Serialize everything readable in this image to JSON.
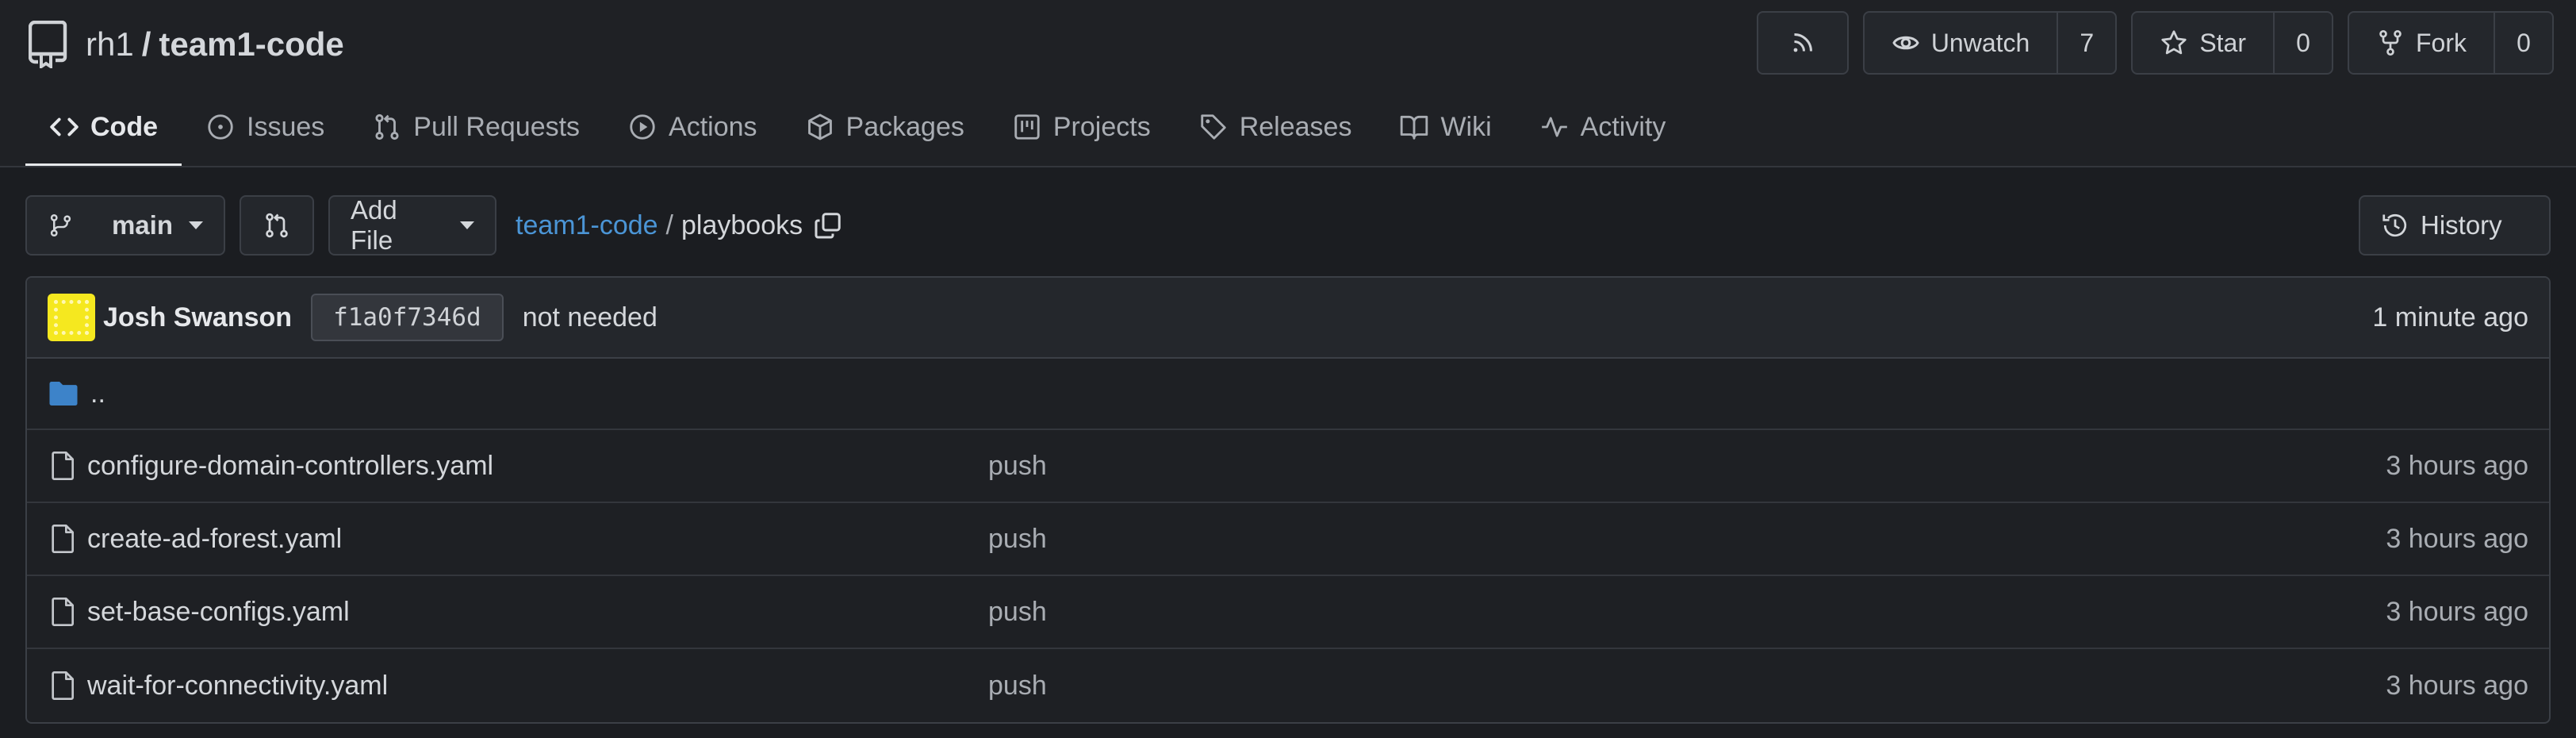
{
  "repo": {
    "owner": "rh1",
    "separator": "/",
    "name": "team1-code"
  },
  "header_actions": {
    "rss_icon": "rss-icon",
    "unwatch": {
      "label": "Unwatch",
      "count": "7",
      "icon": "eye-icon"
    },
    "star": {
      "label": "Star",
      "count": "0",
      "icon": "star-icon"
    },
    "fork": {
      "label": "Fork",
      "count": "0",
      "icon": "fork-icon"
    }
  },
  "tabs": [
    {
      "label": "Code",
      "icon": "code-icon",
      "active": true
    },
    {
      "label": "Issues",
      "icon": "issue-icon"
    },
    {
      "label": "Pull Requests",
      "icon": "pull-request-icon"
    },
    {
      "label": "Actions",
      "icon": "play-icon"
    },
    {
      "label": "Packages",
      "icon": "package-icon"
    },
    {
      "label": "Projects",
      "icon": "project-icon"
    },
    {
      "label": "Releases",
      "icon": "tag-icon"
    },
    {
      "label": "Wiki",
      "icon": "book-icon"
    },
    {
      "label": "Activity",
      "icon": "pulse-icon"
    }
  ],
  "toolbar": {
    "branch": "main",
    "add_file": "Add File",
    "breadcrumb": {
      "repo": "team1-code",
      "separator": "/",
      "current": "playbooks"
    },
    "history": "History"
  },
  "latest_commit": {
    "author": "Josh Swanson",
    "sha": "f1a0f7346d",
    "message": "not needed",
    "time": "1 minute ago"
  },
  "parent_dir": "..",
  "files": [
    {
      "name": "configure-domain-controllers.yaml",
      "message": "push",
      "time": "3 hours ago"
    },
    {
      "name": "create-ad-forest.yaml",
      "message": "push",
      "time": "3 hours ago"
    },
    {
      "name": "set-base-configs.yaml",
      "message": "push",
      "time": "3 hours ago"
    },
    {
      "name": "wait-for-connectivity.yaml",
      "message": "push",
      "time": "3 hours ago"
    }
  ],
  "colors": {
    "link": "#4b95d6",
    "folder": "#3d83c9",
    "avatar": "#f5e81f",
    "background": "#1b1d21"
  }
}
